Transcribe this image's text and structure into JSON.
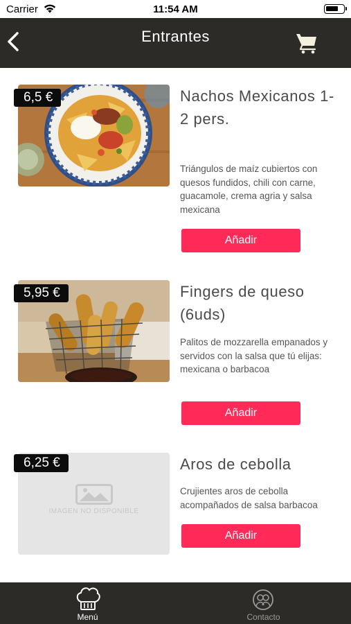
{
  "status_bar": {
    "carrier": "Carrier",
    "time": "11:54 AM"
  },
  "nav": {
    "title": "Entrantes",
    "back_icon": "chevron-left-icon",
    "cart_icon": "cart-icon"
  },
  "products": [
    {
      "name": "Nachos Mexicanos 1-2 pers.",
      "price": "6,5 €",
      "description": "Triángulos de maíz cubiertos con quesos fundidos, chili con carne, guacamole, crema agria y salsa mexicana",
      "button_label": "Añadir"
    },
    {
      "name": "Fingers de queso (6uds)",
      "price": "5,95 €",
      "description": "Palitos de mozzarella empanados y servidos con la salsa que tú elijas: mexicana o barbacoa",
      "button_label": "Añadir"
    },
    {
      "name": "Aros de cebolla",
      "price": "6,25 €",
      "description": "Crujientes aros de cebolla acompañados de salsa barbacoa",
      "button_label": "Añadir",
      "placeholder_text": "IMAGEN NO DISPONIBLE"
    }
  ],
  "tabs": [
    {
      "label": "Menú",
      "icon": "chef-hat-icon",
      "active": true
    },
    {
      "label": "Contacto",
      "icon": "contact-icon",
      "active": false
    }
  ],
  "colors": {
    "header": "#2d2b27",
    "accent": "#ff2a57",
    "price_tag": "#0c0c0c"
  }
}
